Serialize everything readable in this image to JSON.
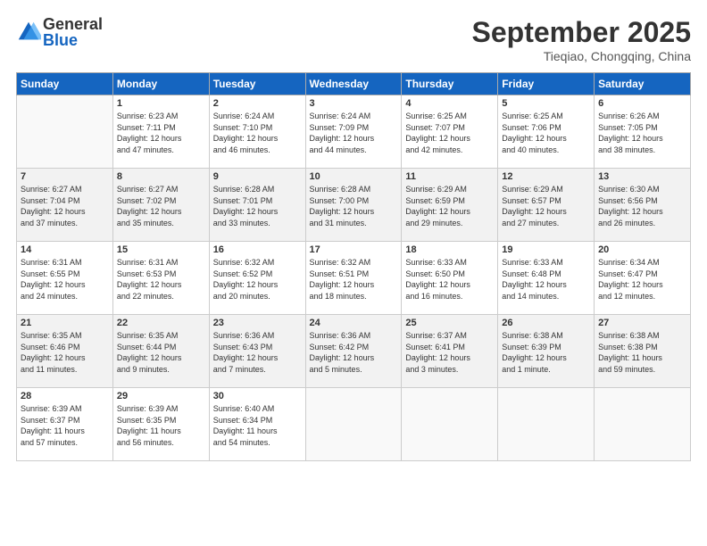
{
  "logo": {
    "general": "General",
    "blue": "Blue"
  },
  "header": {
    "month": "September 2025",
    "location": "Tieqiao, Chongqing, China"
  },
  "weekdays": [
    "Sunday",
    "Monday",
    "Tuesday",
    "Wednesday",
    "Thursday",
    "Friday",
    "Saturday"
  ],
  "weeks": [
    [
      {
        "day": "",
        "info": ""
      },
      {
        "day": "1",
        "info": "Sunrise: 6:23 AM\nSunset: 7:11 PM\nDaylight: 12 hours\nand 47 minutes."
      },
      {
        "day": "2",
        "info": "Sunrise: 6:24 AM\nSunset: 7:10 PM\nDaylight: 12 hours\nand 46 minutes."
      },
      {
        "day": "3",
        "info": "Sunrise: 6:24 AM\nSunset: 7:09 PM\nDaylight: 12 hours\nand 44 minutes."
      },
      {
        "day": "4",
        "info": "Sunrise: 6:25 AM\nSunset: 7:07 PM\nDaylight: 12 hours\nand 42 minutes."
      },
      {
        "day": "5",
        "info": "Sunrise: 6:25 AM\nSunset: 7:06 PM\nDaylight: 12 hours\nand 40 minutes."
      },
      {
        "day": "6",
        "info": "Sunrise: 6:26 AM\nSunset: 7:05 PM\nDaylight: 12 hours\nand 38 minutes."
      }
    ],
    [
      {
        "day": "7",
        "info": "Sunrise: 6:27 AM\nSunset: 7:04 PM\nDaylight: 12 hours\nand 37 minutes."
      },
      {
        "day": "8",
        "info": "Sunrise: 6:27 AM\nSunset: 7:02 PM\nDaylight: 12 hours\nand 35 minutes."
      },
      {
        "day": "9",
        "info": "Sunrise: 6:28 AM\nSunset: 7:01 PM\nDaylight: 12 hours\nand 33 minutes."
      },
      {
        "day": "10",
        "info": "Sunrise: 6:28 AM\nSunset: 7:00 PM\nDaylight: 12 hours\nand 31 minutes."
      },
      {
        "day": "11",
        "info": "Sunrise: 6:29 AM\nSunset: 6:59 PM\nDaylight: 12 hours\nand 29 minutes."
      },
      {
        "day": "12",
        "info": "Sunrise: 6:29 AM\nSunset: 6:57 PM\nDaylight: 12 hours\nand 27 minutes."
      },
      {
        "day": "13",
        "info": "Sunrise: 6:30 AM\nSunset: 6:56 PM\nDaylight: 12 hours\nand 26 minutes."
      }
    ],
    [
      {
        "day": "14",
        "info": "Sunrise: 6:31 AM\nSunset: 6:55 PM\nDaylight: 12 hours\nand 24 minutes."
      },
      {
        "day": "15",
        "info": "Sunrise: 6:31 AM\nSunset: 6:53 PM\nDaylight: 12 hours\nand 22 minutes."
      },
      {
        "day": "16",
        "info": "Sunrise: 6:32 AM\nSunset: 6:52 PM\nDaylight: 12 hours\nand 20 minutes."
      },
      {
        "day": "17",
        "info": "Sunrise: 6:32 AM\nSunset: 6:51 PM\nDaylight: 12 hours\nand 18 minutes."
      },
      {
        "day": "18",
        "info": "Sunrise: 6:33 AM\nSunset: 6:50 PM\nDaylight: 12 hours\nand 16 minutes."
      },
      {
        "day": "19",
        "info": "Sunrise: 6:33 AM\nSunset: 6:48 PM\nDaylight: 12 hours\nand 14 minutes."
      },
      {
        "day": "20",
        "info": "Sunrise: 6:34 AM\nSunset: 6:47 PM\nDaylight: 12 hours\nand 12 minutes."
      }
    ],
    [
      {
        "day": "21",
        "info": "Sunrise: 6:35 AM\nSunset: 6:46 PM\nDaylight: 12 hours\nand 11 minutes."
      },
      {
        "day": "22",
        "info": "Sunrise: 6:35 AM\nSunset: 6:44 PM\nDaylight: 12 hours\nand 9 minutes."
      },
      {
        "day": "23",
        "info": "Sunrise: 6:36 AM\nSunset: 6:43 PM\nDaylight: 12 hours\nand 7 minutes."
      },
      {
        "day": "24",
        "info": "Sunrise: 6:36 AM\nSunset: 6:42 PM\nDaylight: 12 hours\nand 5 minutes."
      },
      {
        "day": "25",
        "info": "Sunrise: 6:37 AM\nSunset: 6:41 PM\nDaylight: 12 hours\nand 3 minutes."
      },
      {
        "day": "26",
        "info": "Sunrise: 6:38 AM\nSunset: 6:39 PM\nDaylight: 12 hours\nand 1 minute."
      },
      {
        "day": "27",
        "info": "Sunrise: 6:38 AM\nSunset: 6:38 PM\nDaylight: 11 hours\nand 59 minutes."
      }
    ],
    [
      {
        "day": "28",
        "info": "Sunrise: 6:39 AM\nSunset: 6:37 PM\nDaylight: 11 hours\nand 57 minutes."
      },
      {
        "day": "29",
        "info": "Sunrise: 6:39 AM\nSunset: 6:35 PM\nDaylight: 11 hours\nand 56 minutes."
      },
      {
        "day": "30",
        "info": "Sunrise: 6:40 AM\nSunset: 6:34 PM\nDaylight: 11 hours\nand 54 minutes."
      },
      {
        "day": "",
        "info": ""
      },
      {
        "day": "",
        "info": ""
      },
      {
        "day": "",
        "info": ""
      },
      {
        "day": "",
        "info": ""
      }
    ]
  ]
}
